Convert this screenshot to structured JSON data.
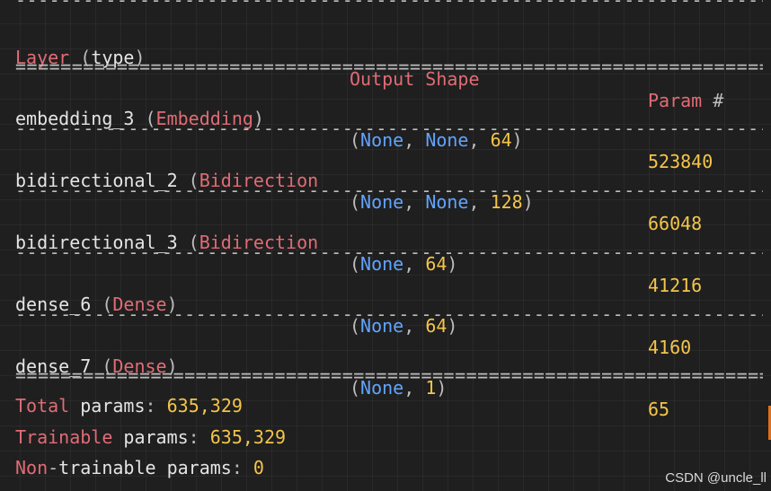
{
  "header": {
    "layer": "Layer",
    "type": "type",
    "output_shape": "Output Shape",
    "param": "Param",
    "hash": "#"
  },
  "separators": {
    "dash": "-------------------------------------------------------------------------------------------------",
    "equals": "================================================================================================="
  },
  "rows": [
    {
      "name": "embedding_3",
      "type": "Embedding",
      "shape": [
        "None",
        "None",
        "64"
      ],
      "params": "523840"
    },
    {
      "name": "bidirectional_2",
      "type": "Bidirection",
      "shape": [
        "None",
        "None",
        "128"
      ],
      "params": "66048"
    },
    {
      "name": "bidirectional_3",
      "type": "Bidirection",
      "shape": [
        "None",
        "64"
      ],
      "params": "41216"
    },
    {
      "name": "dense_6",
      "type": "Dense",
      "shape": [
        "None",
        "64"
      ],
      "params": "4160"
    },
    {
      "name": "dense_7",
      "type": "Dense",
      "shape": [
        "None",
        "1"
      ],
      "params": "65"
    }
  ],
  "totals": {
    "total": {
      "word": "Total",
      "label": "params",
      "value": "635,329"
    },
    "trainable": {
      "word": "Trainable",
      "label": "params",
      "value": "635,329"
    },
    "non_trainable": {
      "word": "Non",
      "label": "trainable params",
      "value": "0"
    }
  },
  "watermark": "CSDN @uncle_ll",
  "colors": {
    "background": "#1f1f1f",
    "red": "#e06c75",
    "blue": "#61a4ff",
    "yellow": "#f4c54a",
    "text": "#e4e4e4"
  }
}
